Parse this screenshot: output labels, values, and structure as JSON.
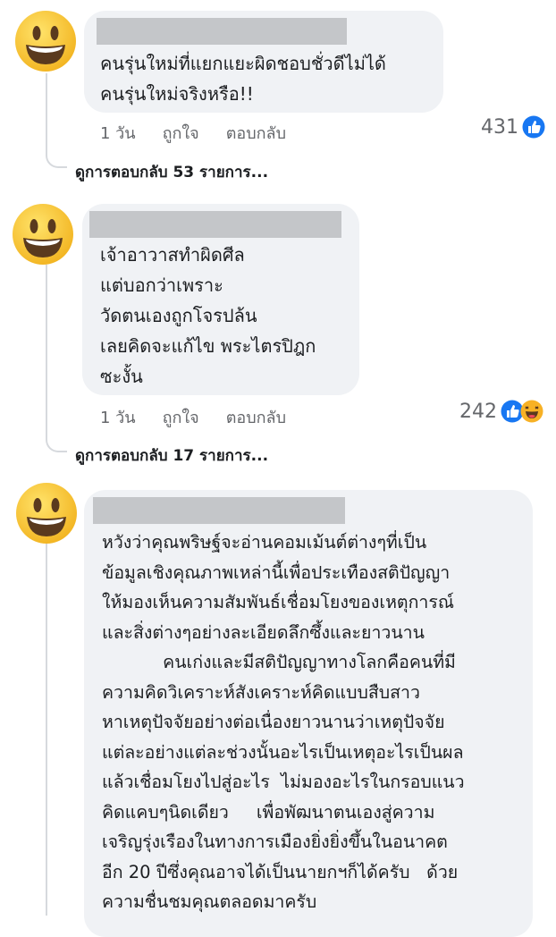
{
  "comments": [
    {
      "text": "คนรุ่นใหม่ที่แยกแยะผิดชอบชั่วดีไม่ได้\nคนรุ่นใหม่จริงหรือ!!",
      "time": "1 วัน",
      "like_label": "ถูกใจ",
      "reply_label": "ตอบกลับ",
      "reaction_count": "431",
      "reaction_icons": [
        "like-icon"
      ],
      "view_replies": "ดูการตอบกลับ 53 รายการ..."
    },
    {
      "text": "เจ้าอาวาสทำผิดศีล\nแต่บอกว่าเพราะ\nวัดตนเองถูกโจรปล้น\nเลยคิดจะแก้ไข พระไตรปิฎก\nซะงั้น",
      "time": "1 วัน",
      "like_label": "ถูกใจ",
      "reply_label": "ตอบกลับ",
      "reaction_count": "242",
      "reaction_icons": [
        "like-icon",
        "haha-icon"
      ],
      "view_replies": "ดูการตอบกลับ 17 รายการ..."
    },
    {
      "text": "หวังว่าคุณพริษฐ์จะอ่านคอมเม้นต์ต่างๆที่เป็น\nข้อมูลเชิงคุณภาพเหล่านี้เพื่อประเทืองสติปัญญา\nให้มองเห็นความสัมพันธ์เชื่อมโยงของเหตุการณ์\nและสิ่งต่างๆอย่างละเอียดลึกซึ้งและยาวนาน\n           คนเก่งและมีสติปัญญาทางโลกคือคนที่มี\nความคิดวิเคราะห์สังเคราะห์คิดแบบสืบสาว\nหาเหตุปัจจัยอย่างต่อเนื่องยาวนานว่าเหตุปัจจัย\nแต่ละอย่างแต่ละช่วงนั้นอะไรเป็นเหตุอะไรเป็นผล\nแล้วเชื่อมโยงไปสู่อะไร  ไม่มองอะไรในกรอบแนว\nคิดแคบๆนิดเดียว     เพื่อพัฒนาตนเองสู่ความ\nเจริญรุ่งเรืองในทางการเมืองยิ่งยิ่งขึ้นในอนาคต\nอีก 20 ปีซึ่งคุณอาจได้เป็นนายกฯก็ได้ครับ   ด้วย\nความชื่นชมคุณตลอดมาครับ"
    }
  ],
  "colors": {
    "bubble": "#f0f2f5",
    "redaction": "#c4c6c9",
    "meta_text": "#65676b",
    "like_blue": "#1877f2",
    "haha_yellow": "#f7b125"
  }
}
